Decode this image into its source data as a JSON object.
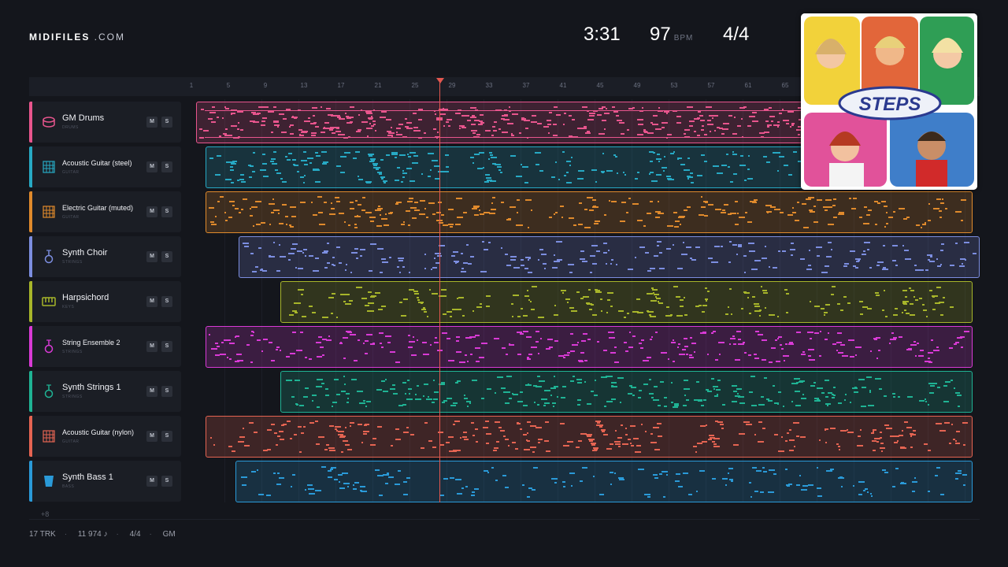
{
  "brand": {
    "name_bold": "MIDIFILES",
    "name_suffix": " .COM"
  },
  "header": {
    "time": "3:31",
    "bpm": "97",
    "bpm_unit": "BPM",
    "time_signature": "4/4"
  },
  "ruler": {
    "ticks": [
      "1",
      "5",
      "9",
      "13",
      "17",
      "21",
      "25",
      "29",
      "33",
      "37",
      "41",
      "45",
      "49",
      "53",
      "57",
      "61",
      "65"
    ]
  },
  "tracks": [
    {
      "name": "GM Drums",
      "category": "DRUMS",
      "color": "#e8558d",
      "icon": "drum-icon",
      "mute": "M",
      "solo": "S"
    },
    {
      "name": "Acoustic Guitar (steel)",
      "category": "GUITAR",
      "color": "#27a9c4",
      "icon": "guitar-icon",
      "mute": "M",
      "solo": "S"
    },
    {
      "name": "Electric Guitar (muted)",
      "category": "GUITAR",
      "color": "#e08a2c",
      "icon": "guitar-icon",
      "mute": "M",
      "solo": "S"
    },
    {
      "name": "Synth Choir",
      "category": "STRINGS",
      "color": "#7c8ee0",
      "icon": "violin-icon",
      "mute": "M",
      "solo": "S"
    },
    {
      "name": "Harpsichord",
      "category": "KEYS",
      "color": "#a7b52a",
      "icon": "keyboard-icon",
      "mute": "M",
      "solo": "S"
    },
    {
      "name": "String Ensemble 2",
      "category": "STRINGS",
      "color": "#d93ad6",
      "icon": "violin-icon",
      "mute": "M",
      "solo": "S"
    },
    {
      "name": "Synth Strings 1",
      "category": "STRINGS",
      "color": "#1fb394",
      "icon": "violin-icon",
      "mute": "M",
      "solo": "S"
    },
    {
      "name": "Acoustic Guitar (nylon)",
      "category": "GUITAR",
      "color": "#e56452",
      "icon": "guitar-icon",
      "mute": "M",
      "solo": "S"
    },
    {
      "name": "Synth Bass 1",
      "category": "BASS",
      "color": "#2a9ad8",
      "icon": "bass-icon",
      "mute": "M",
      "solo": "S"
    }
  ],
  "more_tracks": "+8",
  "footer": {
    "tracks": "17 TRK",
    "notes": "11 974 ♪",
    "signature": "4/4",
    "standard": "GM"
  },
  "album": {
    "artist_logo": "STEPS"
  }
}
